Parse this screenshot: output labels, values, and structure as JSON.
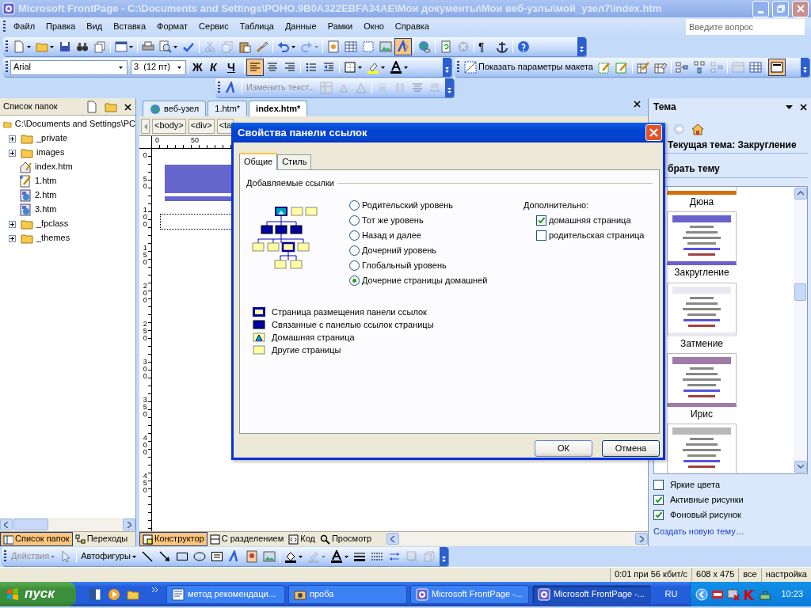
{
  "window": {
    "title": "Microsoft FrontPage - C:\\Documents and Settings\\РОНО.9B0A322EBFA34AE\\Мои документы\\Мои веб-узлы\\мой_узел7\\index.htm"
  },
  "menu": [
    "Файл",
    "Правка",
    "Вид",
    "Вставка",
    "Формат",
    "Сервис",
    "Таблица",
    "Данные",
    "Рамки",
    "Окно",
    "Справка"
  ],
  "help_search": {
    "placeholder": "Введите вопрос"
  },
  "standard_toolbar": [
    [
      {
        "kind": "new",
        "dropdown": true,
        "disabled": false,
        "pressed": false
      },
      {
        "kind": "open",
        "dropdown": true,
        "disabled": false,
        "pressed": false
      },
      {
        "kind": "save",
        "dropdown": false,
        "disabled": false,
        "pressed": false
      },
      {
        "kind": "search",
        "dropdown": false,
        "disabled": false,
        "pressed": false
      },
      {
        "kind": "publish",
        "dropdown": false,
        "disabled": false,
        "pressed": false
      }
    ],
    [
      {
        "kind": "web-component",
        "dropdown": true,
        "disabled": false,
        "pressed": false
      }
    ],
    [
      {
        "kind": "print",
        "dropdown": false,
        "disabled": false,
        "pressed": false
      },
      {
        "kind": "preview",
        "dropdown": true,
        "disabled": false,
        "pressed": false
      },
      {
        "kind": "spelling",
        "dropdown": false,
        "disabled": false,
        "pressed": false
      }
    ],
    [
      {
        "kind": "cut",
        "dropdown": false,
        "disabled": true,
        "pressed": false
      },
      {
        "kind": "copy",
        "dropdown": false,
        "disabled": true,
        "pressed": false
      },
      {
        "kind": "paste",
        "dropdown": false,
        "disabled": false,
        "pressed": false
      },
      {
        "kind": "format-painter",
        "dropdown": false,
        "disabled": false,
        "pressed": false
      }
    ],
    [
      {
        "kind": "undo",
        "dropdown": true,
        "disabled": false,
        "pressed": false
      },
      {
        "kind": "redo",
        "dropdown": true,
        "disabled": true,
        "pressed": false
      }
    ],
    [
      {
        "kind": "component",
        "dropdown": false,
        "disabled": false,
        "pressed": false
      },
      {
        "kind": "table",
        "dropdown": false,
        "disabled": false,
        "pressed": false
      },
      {
        "kind": "layer",
        "dropdown": false,
        "disabled": false,
        "pressed": false
      },
      {
        "kind": "picture",
        "dropdown": false,
        "disabled": false,
        "pressed": false
      },
      {
        "kind": "drawing",
        "dropdown": false,
        "disabled": false,
        "pressed": true
      }
    ],
    [
      {
        "kind": "hyperlink",
        "dropdown": false,
        "disabled": false,
        "pressed": false
      }
    ],
    [
      {
        "kind": "refresh",
        "dropdown": false,
        "disabled": false,
        "pressed": false
      },
      {
        "kind": "stop",
        "dropdown": false,
        "disabled": true,
        "pressed": false
      }
    ],
    [
      {
        "kind": "show-all",
        "text": "¶",
        "dropdown": false,
        "disabled": false,
        "pressed": false
      },
      {
        "kind": "bookmark",
        "dropdown": false,
        "disabled": false,
        "pressed": false
      }
    ],
    [
      {
        "kind": "help",
        "dropdown": false,
        "disabled": false,
        "pressed": false
      }
    ]
  ],
  "formatting_toolbar": {
    "font": "Arial",
    "size": "3  (12 пт)",
    "groups": [
      [
        {
          "kind": "bold",
          "text": "Ж",
          "dropdown": false,
          "disabled": false,
          "pressed": false
        },
        {
          "kind": "italic",
          "text": "К",
          "dropdown": false,
          "disabled": false,
          "pressed": false
        },
        {
          "kind": "underline",
          "text": "Ч",
          "dropdown": false,
          "disabled": false,
          "pressed": false
        }
      ],
      [
        {
          "kind": "align-left",
          "dropdown": false,
          "disabled": false,
          "pressed": true
        },
        {
          "kind": "align-center",
          "dropdown": false,
          "disabled": false,
          "pressed": false
        },
        {
          "kind": "align-right",
          "dropdown": false,
          "disabled": false,
          "pressed": false
        }
      ],
      [
        {
          "kind": "bullets",
          "dropdown": false,
          "disabled": false,
          "pressed": false
        },
        {
          "kind": "outdent",
          "dropdown": false,
          "disabled": false,
          "pressed": false
        }
      ],
      [
        {
          "kind": "borders",
          "dropdown": true,
          "disabled": false,
          "pressed": false
        },
        {
          "kind": "highlight",
          "dropdown": true,
          "disabled": false,
          "pressed": false
        },
        {
          "kind": "font-color",
          "dropdown": true,
          "disabled": false,
          "pressed": false
        }
      ]
    ]
  },
  "tables_toolbar": [
    [
      {
        "kind": "layout-tables",
        "text": "Показать параметры макета",
        "dropdown": false,
        "disabled": false,
        "pressed": false
      },
      {
        "kind": "layout-table",
        "dropdown": false,
        "disabled": false,
        "pressed": false
      },
      {
        "kind": "layout-cell",
        "dropdown": false,
        "disabled": false,
        "pressed": false
      }
    ],
    [
      {
        "kind": "draw-table",
        "dropdown": false,
        "disabled": false,
        "pressed": false
      },
      {
        "kind": "eraser",
        "dropdown": false,
        "disabled": false,
        "pressed": false
      }
    ],
    [
      {
        "kind": "insert-left",
        "dropdown": false,
        "disabled": false,
        "pressed": false
      },
      {
        "kind": "insert-above",
        "dropdown": false,
        "disabled": false,
        "pressed": false
      },
      {
        "kind": "insert-right",
        "dropdown": false,
        "disabled": true,
        "pressed": false
      }
    ],
    [
      {
        "kind": "cell-shading",
        "dropdown": false,
        "disabled": true,
        "pressed": false
      },
      {
        "kind": "grid",
        "dropdown": false,
        "disabled": false,
        "pressed": false
      }
    ],
    [
      {
        "kind": "cell-formatting",
        "dropdown": false,
        "disabled": false,
        "pressed": true
      }
    ]
  ],
  "wordart_toolbar": [
    [
      {
        "kind": "insert-wordart",
        "dropdown": false,
        "disabled": false,
        "pressed": false
      }
    ],
    [
      {
        "kind": "edit-text",
        "text": "Изменить текст...",
        "dropdown": false,
        "disabled": true,
        "pressed": false
      },
      {
        "kind": "gallery",
        "dropdown": false,
        "disabled": true,
        "pressed": false
      },
      {
        "kind": "format-wordart",
        "dropdown": false,
        "disabled": true,
        "pressed": false
      },
      {
        "kind": "shape",
        "dropdown": false,
        "disabled": true,
        "pressed": false
      }
    ],
    [
      {
        "kind": "same-height",
        "dropdown": false,
        "disabled": true,
        "pressed": false
      },
      {
        "kind": "vertical",
        "dropdown": false,
        "disabled": true,
        "pressed": false
      },
      {
        "kind": "text-align",
        "dropdown": false,
        "disabled": true,
        "pressed": false
      },
      {
        "kind": "spacing",
        "dropdown": false,
        "disabled": true,
        "pressed": false
      }
    ]
  ],
  "folder_list": {
    "title": "Список папок",
    "root": "C:\\Documents and Settings\\PC",
    "children": [
      {
        "label": "_private",
        "kind": "folder",
        "expanded": false
      },
      {
        "label": "images",
        "kind": "folder",
        "expanded": false
      },
      {
        "label": "index.htm",
        "kind": "home"
      },
      {
        "label": "1.htm",
        "kind": "edited"
      },
      {
        "label": "2.htm",
        "kind": "page"
      },
      {
        "label": "3.htm",
        "kind": "page"
      },
      {
        "label": "_fpclass",
        "kind": "folder",
        "expanded": false
      },
      {
        "label": "_themes",
        "kind": "folder",
        "expanded": false
      }
    ]
  },
  "panel_tabs": [
    {
      "label": "Список папок",
      "selected": true
    },
    {
      "label": "Переходы",
      "selected": false
    }
  ],
  "document_tabs": [
    {
      "label": "веб-узел",
      "selected": false
    },
    {
      "label": "1.htm*",
      "selected": false
    },
    {
      "label": "index.htm*",
      "selected": true
    }
  ],
  "tag_path": [
    "<body>",
    "<div>",
    "<ta"
  ],
  "ruler": {
    "horizontal": [
      "0",
      "50"
    ],
    "vertical": [
      "0",
      "50",
      "100",
      "150",
      "200",
      "250",
      "300",
      "350",
      "400",
      "450"
    ]
  },
  "view_tabs": [
    {
      "label": "Конструктор",
      "selected": true
    },
    {
      "label": "С разделением",
      "selected": false
    },
    {
      "label": "Код",
      "selected": false
    },
    {
      "label": "Просмотр",
      "selected": false
    }
  ],
  "task_pane": {
    "title": "Тема",
    "current": "Текущая тема: Закругление",
    "choose": "брать тему",
    "themes": [
      {
        "name": "Дюна",
        "color": "#d4700a"
      },
      {
        "name": "Закругление",
        "color": "#6a62cc"
      },
      {
        "name": "Затмение",
        "color": "#e8e8f0"
      },
      {
        "name": "Ирис",
        "color": "#a07aa8"
      },
      {
        "color": "#b8b8b8"
      }
    ],
    "options": [
      {
        "label": "Яркие цвета",
        "checked": false
      },
      {
        "label": "Активные рисунки",
        "checked": true
      },
      {
        "label": "Фоновый рисунок",
        "checked": true
      }
    ],
    "link": "Создать новую тему…"
  },
  "dialog": {
    "title": "Свойства панели ссылок",
    "tabs": [
      {
        "label": "Общие",
        "selected": true
      },
      {
        "label": "Стиль",
        "selected": false
      }
    ],
    "group": "Добавляемые ссылки",
    "levels": [
      {
        "label": "Родительский уровень",
        "selected": false
      },
      {
        "label": "Тот же уровень",
        "selected": false
      },
      {
        "label": "Назад и далее",
        "selected": false
      },
      {
        "label": "Дочерний уровень",
        "selected": false
      },
      {
        "label": "Глобальный уровень",
        "selected": false
      },
      {
        "label": "Дочерние страницы домашней",
        "selected": true
      }
    ],
    "extra_title": "Дополнительно:",
    "extras": [
      {
        "label": "домашняя страница",
        "checked": true
      },
      {
        "label": "родительская страница",
        "checked": false
      }
    ],
    "legend": [
      {
        "kind": "placement",
        "label": "Страница размещения панели ссылок"
      },
      {
        "kind": "linked",
        "label": "Связанные с панелью ссылок страницы"
      },
      {
        "kind": "home",
        "label": "Домашняя страница"
      },
      {
        "kind": "other",
        "label": "Другие страницы"
      }
    ],
    "buttons": [
      "ОК",
      "Отмена"
    ]
  },
  "drawing_toolbar": [
    [
      {
        "kind": "actions",
        "text": "Действия",
        "dropdown": true,
        "disabled": true,
        "pressed": false
      },
      {
        "kind": "select",
        "dropdown": false,
        "disabled": true,
        "pressed": false
      }
    ],
    [
      {
        "kind": "autoshapes",
        "text": "Автофигуры",
        "dropdown": true,
        "disabled": false,
        "pressed": false
      },
      {
        "kind": "line",
        "dropdown": false,
        "disabled": false,
        "pressed": false
      },
      {
        "kind": "arrow",
        "dropdown": false,
        "disabled": false,
        "pressed": false
      },
      {
        "kind": "rectangle",
        "dropdown": false,
        "disabled": false,
        "pressed": false
      },
      {
        "kind": "oval",
        "dropdown": false,
        "disabled": false,
        "pressed": false
      },
      {
        "kind": "textbox",
        "dropdown": false,
        "disabled": false,
        "pressed": false
      },
      {
        "kind": "insert-wordart",
        "dropdown": false,
        "disabled": false,
        "pressed": false
      },
      {
        "kind": "clipart",
        "dropdown": false,
        "disabled": false,
        "pressed": false
      },
      {
        "kind": "picture",
        "dropdown": false,
        "disabled": false,
        "pressed": false
      }
    ],
    [
      {
        "kind": "fill",
        "dropdown": true,
        "disabled": false,
        "pressed": false
      },
      {
        "kind": "line-color",
        "dropdown": true,
        "disabled": true,
        "pressed": false
      },
      {
        "kind": "font-color",
        "dropdown": true,
        "disabled": false,
        "pressed": false
      },
      {
        "kind": "line-style",
        "dropdown": false,
        "disabled": false,
        "pressed": false
      },
      {
        "kind": "dash-style",
        "dropdown": false,
        "disabled": false,
        "pressed": false
      },
      {
        "kind": "arrow-style",
        "dropdown": false,
        "disabled": false,
        "pressed": false
      },
      {
        "kind": "shadow",
        "dropdown": false,
        "disabled": true,
        "pressed": false
      },
      {
        "kind": "depth",
        "dropdown": false,
        "disabled": true,
        "pressed": false
      }
    ]
  ],
  "status_bar": [
    "0:01 при 56 кбит/с",
    "608 x 475",
    "все",
    "настройка"
  ],
  "taskbar": {
    "start": "пуск",
    "tasks": [
      {
        "label": "метод рекомендаци...",
        "kind": "word",
        "selected": false
      },
      {
        "label": "проба",
        "kind": "camera",
        "selected": false
      },
      {
        "label": "Microsoft FrontPage -...",
        "kind": "frontpage",
        "selected": false
      },
      {
        "label": "Microsoft FrontPage -...",
        "kind": "frontpage",
        "selected": true
      }
    ],
    "language": "RU",
    "clock": "10:23"
  }
}
